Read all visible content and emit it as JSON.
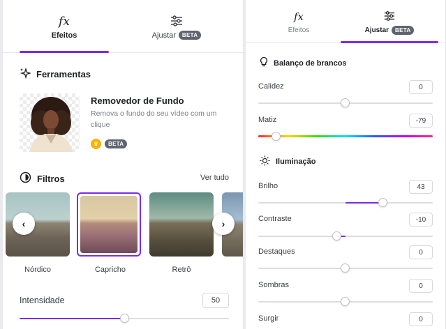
{
  "left": {
    "tabs": [
      {
        "label": "Efeitos",
        "icon": "fx-icon",
        "glyph": "fx"
      },
      {
        "label": "Ajustar",
        "icon": "sliders-icon",
        "badge": "BETA"
      }
    ],
    "tools": {
      "title": "Ferramentas",
      "item": {
        "title": "Removedor de Fundo",
        "description": "Remova o fundo do seu vídeo com um clique",
        "badge": "BETA"
      }
    },
    "filters": {
      "title": "Filtros",
      "see_all": "Ver tudo",
      "items": [
        {
          "name": "Nórdico",
          "selected": false
        },
        {
          "name": "Capricho",
          "selected": true
        },
        {
          "name": "Retrô",
          "selected": false
        }
      ]
    },
    "intensity": {
      "label": "Intensidade",
      "value": "50"
    }
  },
  "right": {
    "tabs": [
      {
        "label": "Efeitos",
        "icon": "fx-icon",
        "glyph": "fx"
      },
      {
        "label": "Ajustar",
        "icon": "sliders-icon",
        "badge": "BETA"
      }
    ],
    "white_balance": {
      "title": "Balanço de brancos",
      "sliders": [
        {
          "label": "Calidez",
          "value": "0"
        },
        {
          "label": "Matiz",
          "value": "-79"
        }
      ]
    },
    "lighting": {
      "title": "Iluminação",
      "sliders": [
        {
          "label": "Brilho",
          "value": "43"
        },
        {
          "label": "Contraste",
          "value": "-10"
        },
        {
          "label": "Destaques",
          "value": "0"
        },
        {
          "label": "Sombras",
          "value": "0"
        },
        {
          "label": "Surgir",
          "value": "0"
        }
      ]
    }
  },
  "colors": {
    "accent": "#7d2ae8",
    "crown": "#f6b300",
    "badge": "#5f6470"
  }
}
